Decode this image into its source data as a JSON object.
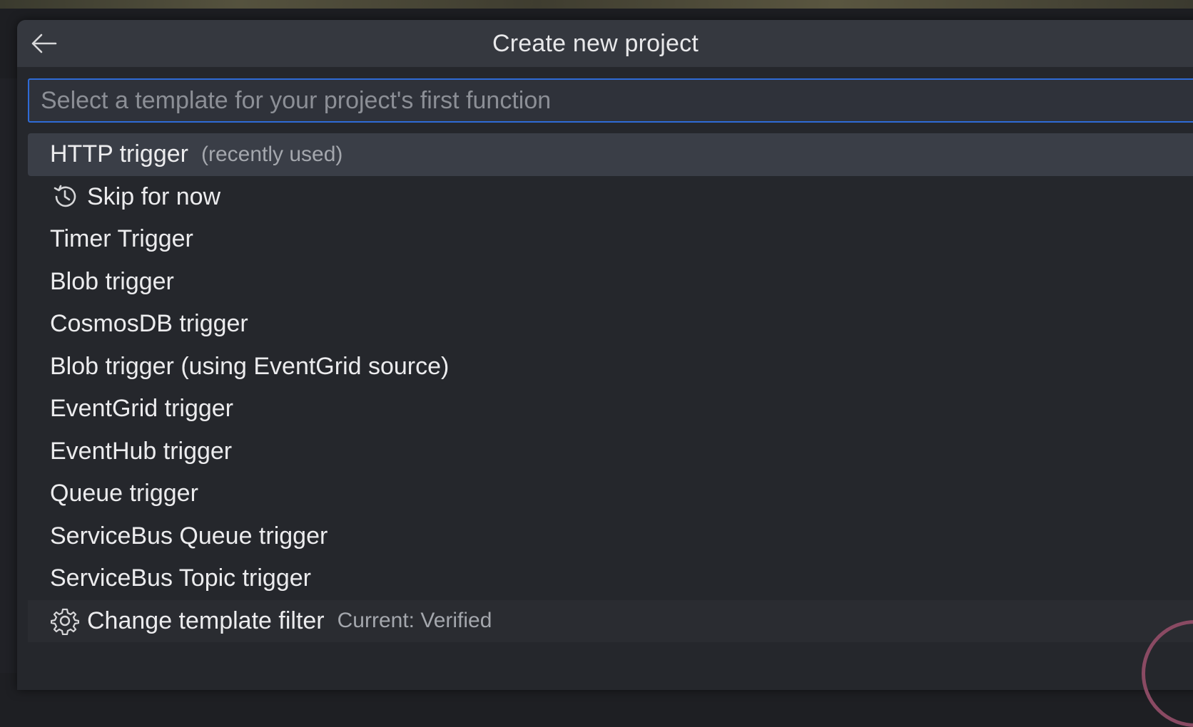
{
  "dialog": {
    "title": "Create new project",
    "back_icon": "arrow-left-icon"
  },
  "search": {
    "placeholder": "Select a template for your project's first function",
    "value": ""
  },
  "items": [
    {
      "label": "HTTP trigger",
      "description": "(recently used)",
      "active": true
    },
    {
      "label": "Skip for now",
      "icon": "history-icon"
    },
    {
      "label": "Timer Trigger"
    },
    {
      "label": "Blob trigger"
    },
    {
      "label": "CosmosDB trigger"
    },
    {
      "label": "Blob trigger (using EventGrid source)"
    },
    {
      "label": "EventGrid trigger"
    },
    {
      "label": "EventHub trigger"
    },
    {
      "label": "Queue trigger"
    },
    {
      "label": "ServiceBus Queue trigger"
    },
    {
      "label": "ServiceBus Topic trigger"
    },
    {
      "label": "Change template filter",
      "description": "Current: Verified",
      "icon": "gear-icon"
    }
  ],
  "colors": {
    "accent_border": "#2f6bd6",
    "active_row": "#3a3e47",
    "header_bg": "#35383f",
    "panel_bg": "#25272c"
  }
}
